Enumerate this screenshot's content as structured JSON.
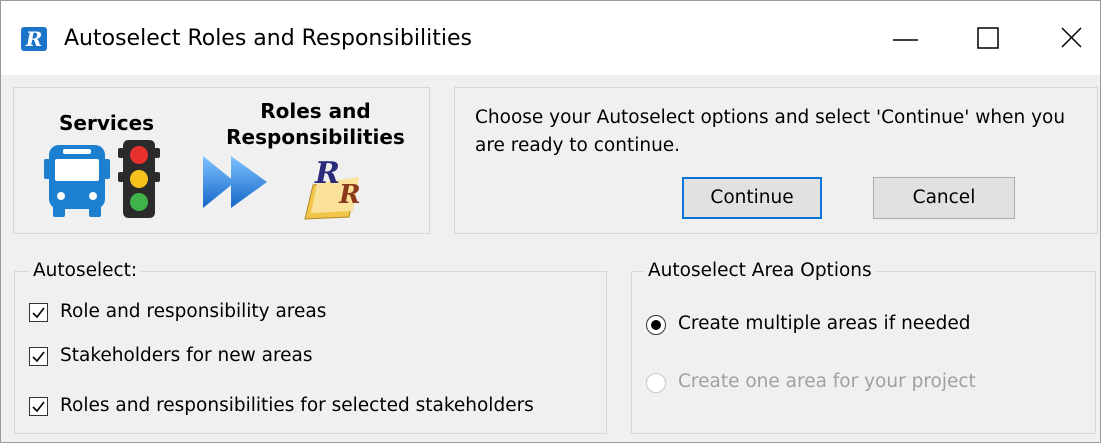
{
  "window": {
    "title": "Autoselect Roles and Responsibilities",
    "app_icon_letter": "R"
  },
  "banner": {
    "services_label": "Services",
    "roles_label_line1": "Roles and",
    "roles_label_line2": "Responsibilities",
    "icons": [
      "bus-icon",
      "traffic-light-icon",
      "double-arrow-icon",
      "roles-book-icon"
    ]
  },
  "info": {
    "message": "Choose your Autoselect options and select 'Continue' when you are ready to continue.",
    "continue_label": "Continue",
    "cancel_label": "Cancel"
  },
  "autoselect": {
    "legend": "Autoselect:",
    "options": [
      {
        "label": "Role and responsibility areas",
        "checked": true
      },
      {
        "label": "Stakeholders for new areas",
        "checked": true
      },
      {
        "label": "Roles and responsibilities for selected stakeholders",
        "checked": true
      }
    ]
  },
  "area_options": {
    "legend": "Autoselect Area Options",
    "options": [
      {
        "label": "Create multiple areas if needed",
        "selected": true,
        "enabled": true
      },
      {
        "label": "Create one area for your project",
        "selected": false,
        "enabled": false
      }
    ]
  },
  "colors": {
    "accent": "#0a74da",
    "bus": "#1c7fd0",
    "arrow": "#2a7fe0"
  }
}
